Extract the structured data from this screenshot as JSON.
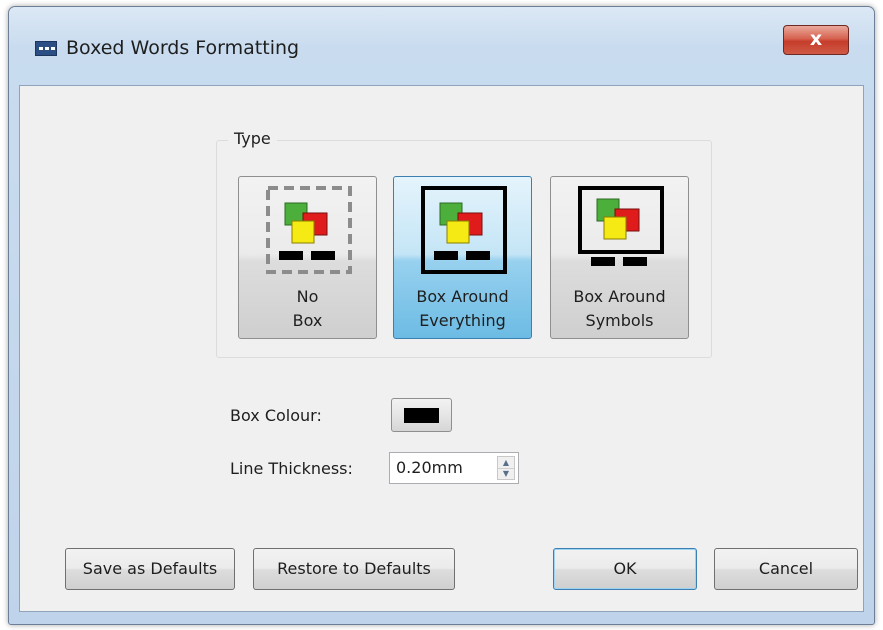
{
  "window": {
    "title": "Boxed Words Formatting",
    "close_glyph": "x"
  },
  "type_group": {
    "legend": "Type",
    "options": [
      {
        "line1": "No",
        "line2": "Box",
        "selected": false,
        "icon": "no-box-icon"
      },
      {
        "line1": "Box Around",
        "line2": "Everything",
        "selected": true,
        "icon": "box-around-everything-icon"
      },
      {
        "line1": "Box Around",
        "line2": "Symbols",
        "selected": false,
        "icon": "box-around-symbols-icon"
      }
    ]
  },
  "box_colour": {
    "label": "Box Colour:",
    "value_color": "#000000"
  },
  "line_thickness": {
    "label": "Line Thickness:",
    "value": "0.20mm"
  },
  "buttons": {
    "save_defaults": "Save as Defaults",
    "restore_defaults": "Restore to Defaults",
    "ok": "OK",
    "cancel": "Cancel"
  },
  "colors": {
    "symbol_green": "#4caf3c",
    "symbol_red": "#e01b1b",
    "symbol_yellow": "#f5ea14",
    "selected_accent": "#6cbbe4"
  }
}
